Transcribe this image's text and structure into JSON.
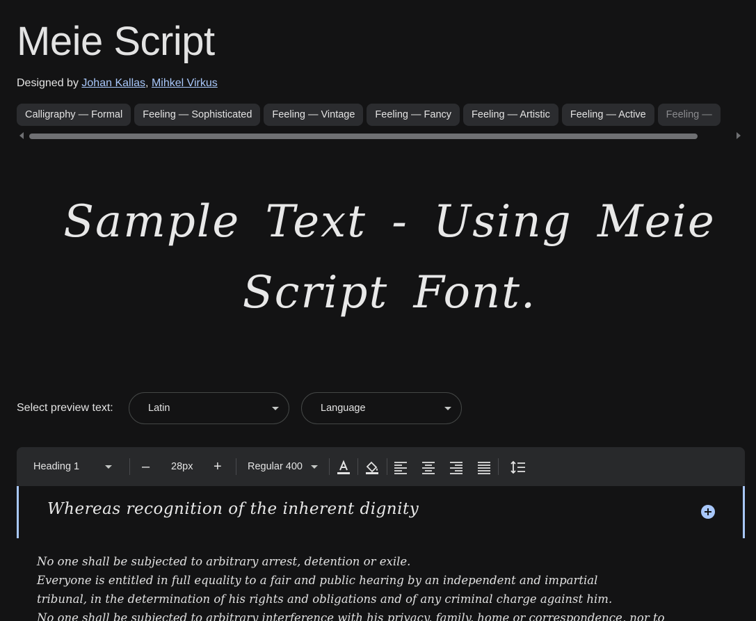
{
  "font": {
    "title": "Meie Script",
    "designed_by_label": "Designed by",
    "designers": [
      "Johan Kallas",
      "Mihkel Virkus"
    ],
    "separator": ","
  },
  "tags": [
    "Calligraphy — Formal",
    "Feeling — Sophisticated",
    "Feeling — Vintage",
    "Feeling — Fancy",
    "Feeling — Artistic",
    "Feeling — Active",
    "Feeling —"
  ],
  "hero": {
    "line1": "Sample Text - Using Meie",
    "line2": "Script Font."
  },
  "preview": {
    "label": "Select preview text:",
    "script_select": "Latin",
    "language_select": "Language"
  },
  "toolbar": {
    "style": "Heading 1",
    "size": "28px",
    "weight": "Regular 400",
    "decrease_label": "–",
    "increase_label": "+"
  },
  "editor": {
    "heading_text": "Whereas recognition of the inherent dignity",
    "body_lines": [
      "No one shall be subjected to arbitrary arrest, detention or exile.",
      " Everyone is entitled in full equality to a fair and public hearing by an independent and impartial",
      "tribunal, in the determination of his rights and obligations and of any criminal charge against him.",
      "No one shall be subjected to arbitrary interference with his privacy, family, home or correspondence, nor to"
    ]
  },
  "colors": {
    "background": "#131314",
    "chip_bg": "#2b2c2f",
    "link": "#a8c7fa",
    "accent": "#a8c7fa"
  }
}
